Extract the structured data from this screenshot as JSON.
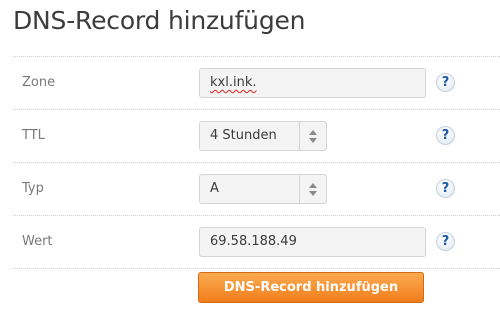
{
  "page": {
    "title": "DNS-Record hinzufügen"
  },
  "form": {
    "zone": {
      "label": "Zone",
      "value": "kxl.ink."
    },
    "ttl": {
      "label": "TTL",
      "value": "4 Stunden"
    },
    "type": {
      "label": "Typ",
      "value": "A"
    },
    "value": {
      "label": "Wert",
      "value": "69.58.188.49"
    },
    "help_symbol": "?"
  },
  "submit": {
    "label": "DNS-Record hinzufügen"
  },
  "colors": {
    "accent": "#f17e1c",
    "help_icon": "#1d5aa8",
    "spellcheck_underline": "#e02020"
  },
  "icons": {
    "help": "question-mark-icon",
    "stepper": "up-down-arrows-icon"
  }
}
